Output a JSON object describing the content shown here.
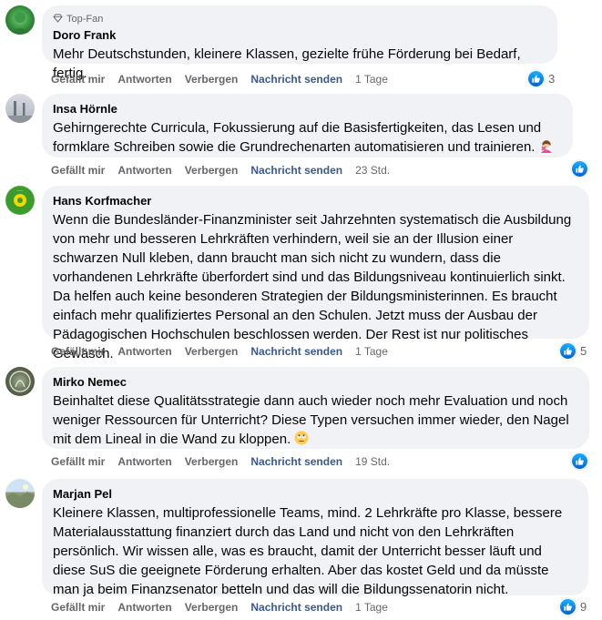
{
  "actions": {
    "like": "Gefällt mir",
    "reply": "Antworten",
    "hide": "Verbergen",
    "send": "Nachricht senden"
  },
  "colors": {
    "bubble": "#f0f2f5",
    "send_link": "#385898",
    "like_blue": "#0866ff"
  },
  "comments": [
    {
      "badge": "Top-Fan",
      "author": "Doro Frank",
      "text": "Mehr Deutschstunden, kleinere Klassen, gezielte frühe Förderung bei Bedarf, fertig.",
      "time": "1 Tage",
      "likes": "3"
    },
    {
      "author": "Insa Hörnle",
      "text": "Gehirngerechte Curricula, Fokussierung auf die Basisfertigkeiten, das Lesen und formklare Schreiben sowie die Grundrechenarten automatisieren und trainieren.",
      "emoji": "person-gesturing-no-emoji",
      "time": "23 Std.",
      "likes": ""
    },
    {
      "author": "Hans Korfmacher",
      "text": "Wenn die Bundesländer-Finanzminister seit Jahrzehnten systematisch die Ausbildung von mehr und besseren Lehrkräften verhindern, weil sie an der Illusion einer schwarzen Null kleben, dann braucht man sich nicht zu wundern, dass die vorhandenen Lehrkräfte überfordert sind und das Bildungsniveau kontinuierlich sinkt. Da helfen auch keine besonderen Strategien der Bildungsministerinnen. Es braucht einfach mehr qualifiziertes Personal an den Schulen. Jetzt muss der Ausbau der Pädagogischen Hochschulen beschlossen werden. Der Rest ist nur politisches Gewäsch.",
      "time": "1 Tage",
      "likes": "5"
    },
    {
      "author": "Mirko Nemec",
      "text": "Beinhaltet diese Qualitätsstrategie dann auch wieder noch mehr Evaluation und noch weniger Ressourcen für Unterricht? Diese Typen versuchen immer wieder, den Nagel mit dem Lineal in die Wand zu kloppen.",
      "emoji": "rolling-eyes-emoji",
      "time": "19 Std.",
      "likes": ""
    },
    {
      "author": "Marjan Pel",
      "text": "Kleinere Klassen, multiprofessionelle Teams, mind. 2 Lehrkräfte pro Klasse, bessere Materialausstattung finanziert durch das Land und nicht von den Lehrkräften persönlich. Wir wissen alle, was es braucht, damit der Unterricht besser läuft und diese SuS die geeignete Förderung erhalten. Aber das kostet Geld und da müsste man ja beim Finanzsenator betteln und das will die Bildungssenatorin nicht.",
      "time": "1 Tage",
      "likes": "9"
    }
  ]
}
